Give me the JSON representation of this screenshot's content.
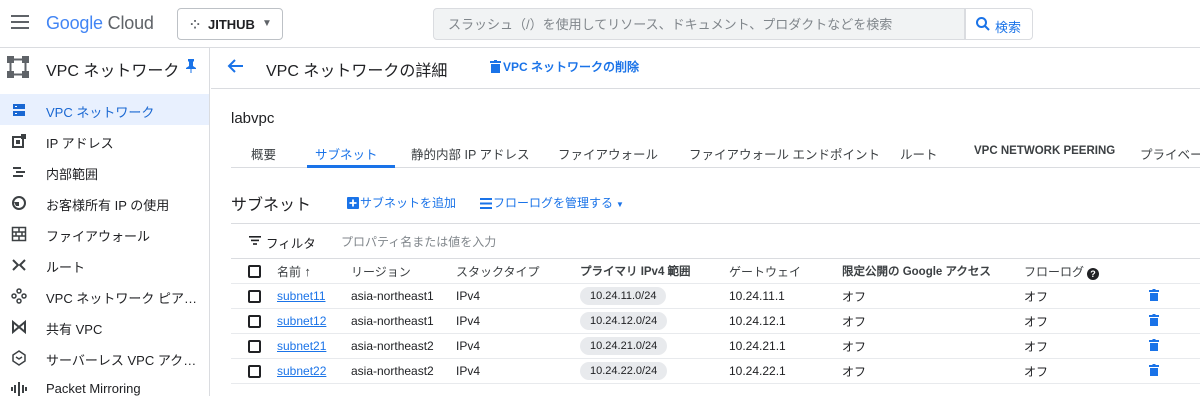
{
  "header": {
    "logo_google": "Google",
    "logo_cloud": "Cloud",
    "project_name": "JITHUB",
    "search_placeholder": "スラッシュ（/）を使用してリソース、ドキュメント、プロダクトなどを検索",
    "search_button": "検索"
  },
  "sidebar": {
    "title": "VPC ネットワーク",
    "items": [
      {
        "label": "VPC ネットワーク",
        "icon": "vpc-network-icon",
        "active": true
      },
      {
        "label": "IP アドレス",
        "icon": "ip-address-icon"
      },
      {
        "label": "内部範囲",
        "icon": "internal-ranges-icon"
      },
      {
        "label": "お客様所有 IP の使用",
        "icon": "globe-ip-icon"
      },
      {
        "label": "ファイアウォール",
        "icon": "firewall-icon"
      },
      {
        "label": "ルート",
        "icon": "routes-icon"
      },
      {
        "label": "VPC ネットワーク ピアリ...",
        "icon": "peering-icon"
      },
      {
        "label": "共有 VPC",
        "icon": "shared-vpc-icon"
      },
      {
        "label": "サーバーレス VPC アクセ...",
        "icon": "serverless-icon"
      },
      {
        "label": "Packet Mirroring",
        "icon": "packet-mirroring-icon"
      }
    ]
  },
  "page": {
    "title": "VPC ネットワークの詳細",
    "delete_button": "VPC ネットワークの削除",
    "network_name": "labvpc",
    "tabs": [
      "概要",
      "サブネット",
      "静的内部 IP アドレス",
      "ファイアウォール",
      "ファイアウォール エンドポイント",
      "ルート",
      "VPC NETWORK PEERING",
      "プライベー"
    ],
    "active_tab": "サブネット"
  },
  "subnets": {
    "section_title": "サブネット",
    "add_button": "サブネットを追加",
    "flowlog_button": "フローログを管理する",
    "filter_label": "フィルタ",
    "filter_placeholder": "プロパティ名または値を入力",
    "columns": [
      "名前",
      "リージョン",
      "スタックタイプ",
      "プライマリ IPv4 範囲",
      "ゲートウェイ",
      "限定公開の Google アクセス",
      "フローログ"
    ],
    "rows": [
      {
        "name": "subnet11",
        "region": "asia-northeast1",
        "stack": "IPv4",
        "range": "10.24.11.0/24",
        "gateway": "10.24.11.1",
        "private_access": "オフ",
        "flowlog": "オフ"
      },
      {
        "name": "subnet12",
        "region": "asia-northeast1",
        "stack": "IPv4",
        "range": "10.24.12.0/24",
        "gateway": "10.24.12.1",
        "private_access": "オフ",
        "flowlog": "オフ"
      },
      {
        "name": "subnet21",
        "region": "asia-northeast2",
        "stack": "IPv4",
        "range": "10.24.21.0/24",
        "gateway": "10.24.21.1",
        "private_access": "オフ",
        "flowlog": "オフ"
      },
      {
        "name": "subnet22",
        "region": "asia-northeast2",
        "stack": "IPv4",
        "range": "10.24.22.0/24",
        "gateway": "10.24.22.1",
        "private_access": "オフ",
        "flowlog": "オフ"
      }
    ]
  },
  "colors": {
    "accent": "#1a73e8",
    "active_bg": "#e8f0fe",
    "chip_bg": "#e8eaed"
  }
}
